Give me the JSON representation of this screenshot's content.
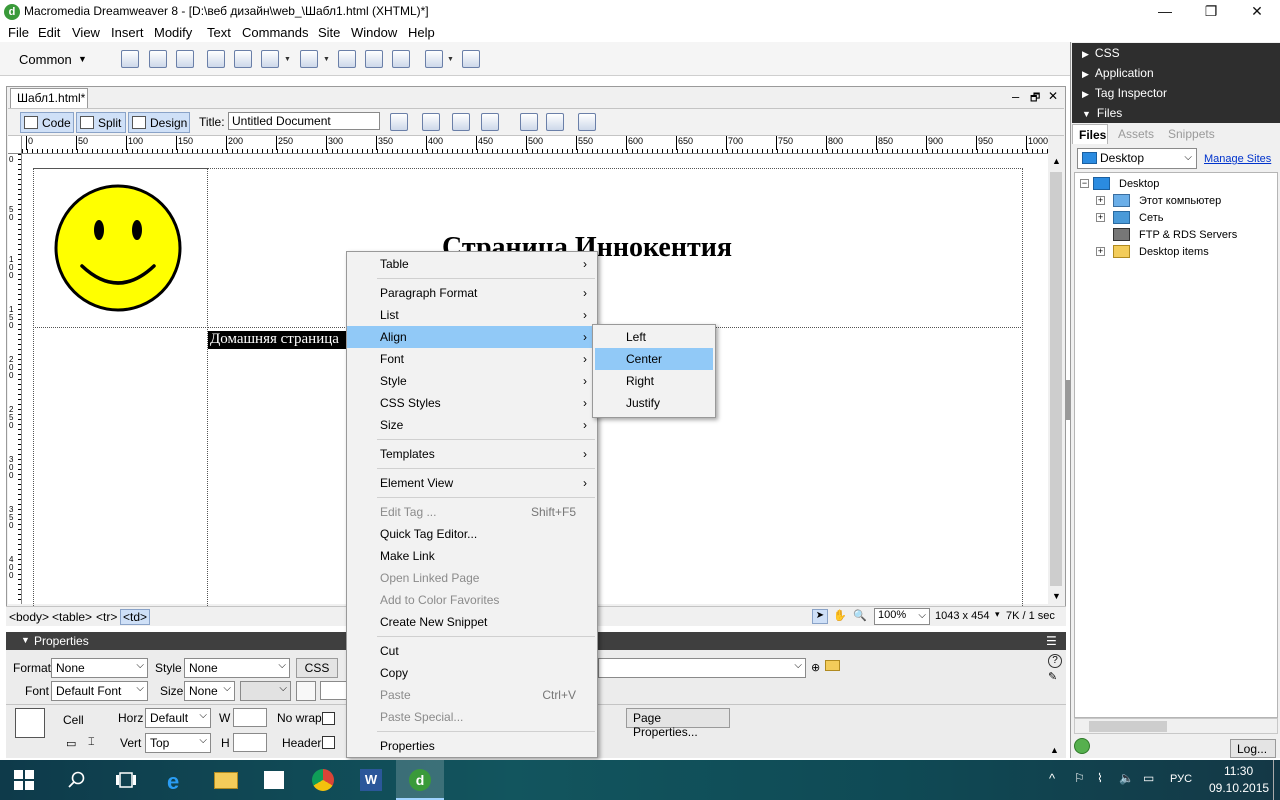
{
  "window": {
    "title": "Macromedia Dreamweaver 8 - [D:\\веб дизайн\\web_\\Шабл1.html (XHTML)*]",
    "app_icon_glyph": "d",
    "minimize_glyph": "—",
    "restore_glyph": "❐",
    "close_glyph": "✕"
  },
  "menu": {
    "items": [
      "File",
      "Edit",
      "View",
      "Insert",
      "Modify",
      "Text",
      "Commands",
      "Site",
      "Window",
      "Help"
    ]
  },
  "insert_toolbar": {
    "category": "Common",
    "dropdown_glyph": "▼"
  },
  "document": {
    "tab_label": "Шабл1.html*",
    "view_buttons": {
      "code": "Code",
      "split": "Split",
      "design": "Design"
    },
    "title_label": "Title:",
    "title_value": "Untitled Document",
    "heading_text": "Страница Иннокентия",
    "home_cell_text": "Домашняя страница",
    "win_controls": {
      "minimize": "–",
      "restore": "🗗",
      "close": "✕"
    }
  },
  "ruler": {
    "h_ticks": [
      "0",
      "50",
      "100",
      "150",
      "200",
      "250",
      "300",
      "350",
      "400",
      "450",
      "500",
      "550",
      "600",
      "650",
      "700",
      "750",
      "800",
      "850",
      "900",
      "950",
      "1000"
    ],
    "v_ticks": [
      "0",
      "50",
      "100",
      "150",
      "200",
      "250",
      "300",
      "350",
      "400"
    ]
  },
  "status": {
    "tag_path": [
      "<body>",
      "<table>",
      "<tr>",
      "<td>"
    ],
    "zoom": "100%",
    "dimensions": "1043 x 454",
    "download": "7K / 1 sec"
  },
  "properties": {
    "header": "Properties",
    "format_label": "Format",
    "format_value": "None",
    "style_label": "Style",
    "style_value": "None",
    "css_button": "CSS",
    "font_label": "Font",
    "font_value": "Default Font",
    "size_label": "Size",
    "size_value": "None",
    "cell_label": "Cell",
    "horz_label": "Horz",
    "horz_value": "Default",
    "vert_label": "Vert",
    "vert_value": "Top",
    "w_label": "W",
    "h_label": "H",
    "nowrap_label": "No wrap",
    "header_label": "Header",
    "page_props_button": "Page Properties...",
    "help_glyph": "?"
  },
  "panels": {
    "groups": [
      "CSS",
      "Application",
      "Tag Inspector",
      "Files"
    ],
    "file_tabs": [
      "Files",
      "Assets",
      "Snippets"
    ],
    "site_value": "Desktop",
    "manage_sites": "Manage Sites",
    "tree": [
      {
        "label": "Desktop",
        "expander": "−",
        "icon": "desktop-icon"
      },
      {
        "label": "Этот компьютер",
        "expander": "+",
        "icon": "computer-icon"
      },
      {
        "label": "Сеть",
        "expander": "+",
        "icon": "network-icon"
      },
      {
        "label": "FTP & RDS Servers",
        "expander": "",
        "icon": "server-icon"
      },
      {
        "label": "Desktop items",
        "expander": "+",
        "icon": "folder-icon"
      }
    ],
    "log_button": "Log..."
  },
  "context_menu": {
    "items": [
      {
        "label": "Table",
        "submenu": true
      },
      {
        "label": "Paragraph Format",
        "submenu": true
      },
      {
        "label": "List",
        "submenu": true
      },
      {
        "label": "Align",
        "submenu": true,
        "highlighted": true
      },
      {
        "label": "Font",
        "submenu": true
      },
      {
        "label": "Style",
        "submenu": true
      },
      {
        "label": "CSS Styles",
        "submenu": true
      },
      {
        "label": "Size",
        "submenu": true
      },
      {
        "label": "Templates",
        "submenu": true
      },
      {
        "label": "Element View",
        "submenu": true
      },
      {
        "label": "Edit Tag ...",
        "shortcut": "Shift+F5",
        "disabled": true
      },
      {
        "label": "Quick Tag Editor..."
      },
      {
        "label": "Make Link"
      },
      {
        "label": "Open Linked Page",
        "disabled": true
      },
      {
        "label": "Add to Color Favorites",
        "disabled": true
      },
      {
        "label": "Create New Snippet"
      },
      {
        "label": "Cut"
      },
      {
        "label": "Copy"
      },
      {
        "label": "Paste",
        "shortcut": "Ctrl+V",
        "disabled": true
      },
      {
        "label": "Paste Special...",
        "disabled": true
      },
      {
        "label": "Properties"
      }
    ],
    "chevron_glyph": "›",
    "align_submenu": [
      {
        "label": "Left"
      },
      {
        "label": "Center",
        "highlighted": true
      },
      {
        "label": "Right"
      },
      {
        "label": "Justify"
      }
    ]
  },
  "taskbar": {
    "language": "РУС",
    "time": "11:30",
    "date": "09.10.2015",
    "tray_up_glyph": "^"
  },
  "colors": {
    "menu_highlight": "#91c9f7",
    "panel_header": "#2e2e2e",
    "smiley_face": "#ffff00",
    "link": "#0033cc"
  }
}
